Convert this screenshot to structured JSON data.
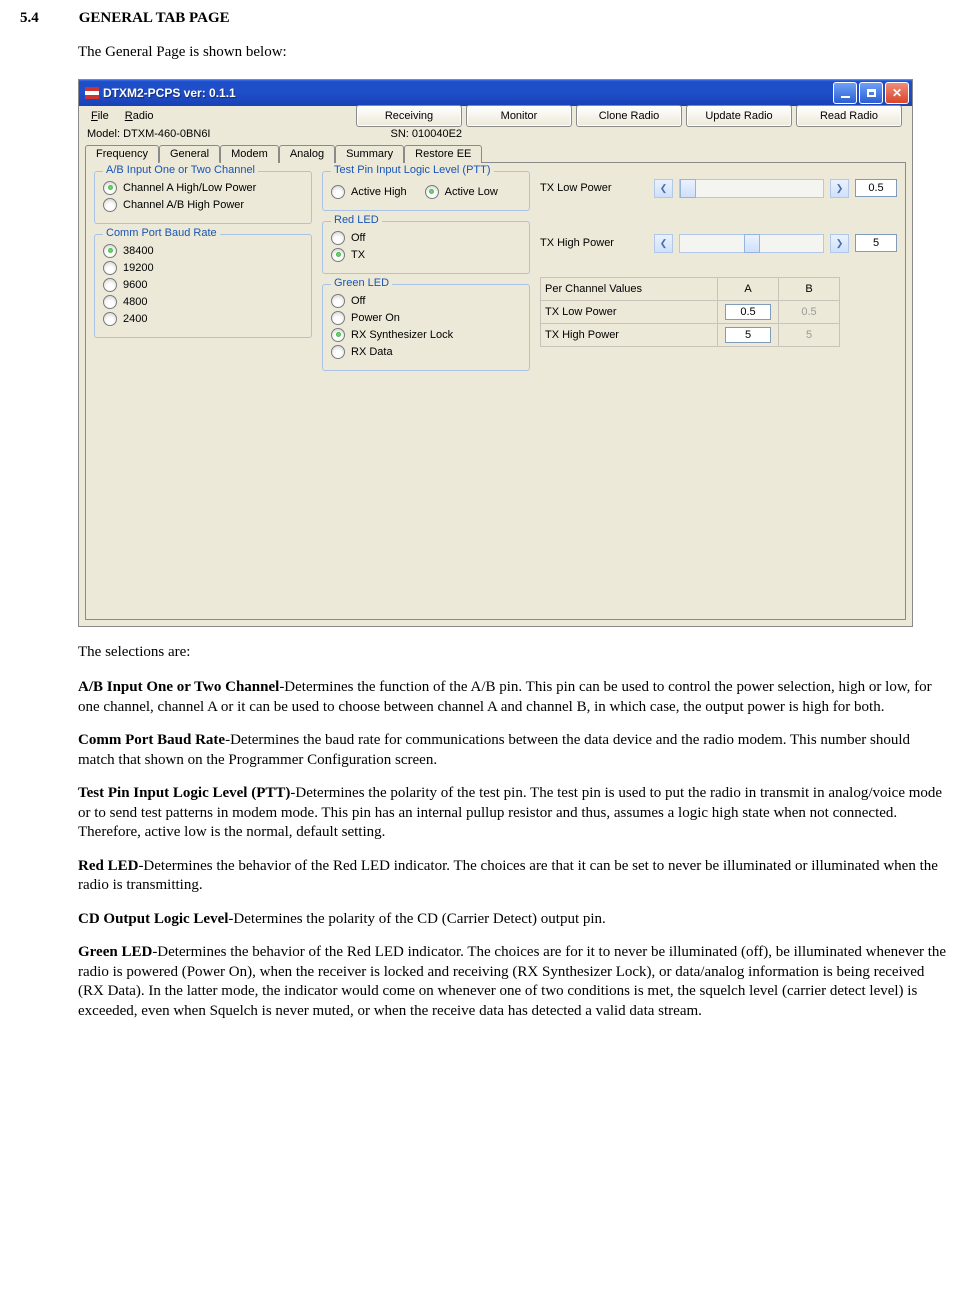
{
  "section": {
    "number": "5.4",
    "title": "GENERAL TAB PAGE"
  },
  "intro": "The General Page is shown below:",
  "window": {
    "title": "DTXM2-PCPS ver: 0.1.1",
    "menus": {
      "file": "File",
      "radio": "Radio"
    },
    "top_buttons": [
      "Receiving",
      "Monitor",
      "Clone Radio",
      "Update Radio",
      "Read Radio"
    ],
    "model_label": "Model: DTXM-460-0BN6I",
    "sn_label": "SN: 010040E2",
    "tabs": [
      "Frequency",
      "General",
      "Modem",
      "Analog",
      "Summary",
      "Restore EE"
    ],
    "active_tab": "General",
    "groups": {
      "ab": {
        "title": "A/B Input One or Two Channel",
        "opts": [
          "Channel A High/Low Power",
          "Channel A/B High Power"
        ],
        "sel": 0
      },
      "baud": {
        "title": "Comm Port Baud Rate",
        "opts": [
          "38400",
          "19200",
          "9600",
          "4800",
          "2400"
        ],
        "sel": 0
      },
      "ptt": {
        "title": "Test Pin Input Logic Level (PTT)",
        "opts": [
          "Active High",
          "Active Low"
        ],
        "sel": 1
      },
      "red": {
        "title": "Red LED",
        "opts": [
          "Off",
          "TX"
        ],
        "sel": 1
      },
      "green": {
        "title": "Green LED",
        "opts": [
          "Off",
          "Power On",
          "RX Synthesizer Lock",
          "RX Data"
        ],
        "sel": 2
      }
    },
    "sliders": {
      "low": {
        "label": "TX Low Power",
        "value": "0.5",
        "pos": 0
      },
      "high": {
        "label": "TX High Power",
        "value": "5",
        "pos": 45
      }
    },
    "table": {
      "header": [
        "Per Channel Values",
        "A",
        "B"
      ],
      "rows": [
        {
          "label": "TX Low Power",
          "a": "0.5",
          "b": "0.5"
        },
        {
          "label": "TX High Power",
          "a": "5",
          "b": "5"
        }
      ]
    }
  },
  "post": "The selections are:",
  "defs": [
    {
      "term": "A/B Input One or Two Channel",
      "text": "-Determines the function of the A/B pin. This pin can be used to control the power selection, high or low, for one channel, channel A or it can be used to choose between channel A and channel B, in which case, the output power is high for both."
    },
    {
      "term": "Comm Port Baud Rate",
      "text": "-Determines the baud rate for communications between the data device and the radio modem. This number should match that shown on the Programmer Configuration screen."
    },
    {
      "term": "Test Pin Input Logic Level (PTT)",
      "text": "-Determines the polarity of the test pin. The test pin is used to put the radio in transmit in analog/voice mode or to send test patterns in modem mode. This pin has an internal pullup resistor and thus, assumes a logic high state when not connected. Therefore, active low is the normal, default setting."
    },
    {
      "term": "Red LED",
      "text": "-Determines the behavior of the Red LED indicator. The choices are that it can be set to never be illuminated or illuminated when the radio is transmitting."
    },
    {
      "term": "CD Output Logic Level",
      "text": "-Determines the polarity of the CD (Carrier Detect) output pin."
    },
    {
      "term": "Green LED",
      "text": "-Determines the behavior of the Red LED indicator. The choices are for it to never be illuminated (off), be illuminated whenever the radio is powered (Power On), when the receiver is locked and receiving (RX Synthesizer Lock), or data/analog information is being received (RX Data). In the latter mode, the indicator would come on whenever one of two conditions is met, the squelch level (carrier detect level) is exceeded, even when Squelch is never muted, or when the receive data has detected a valid data stream."
    }
  ]
}
